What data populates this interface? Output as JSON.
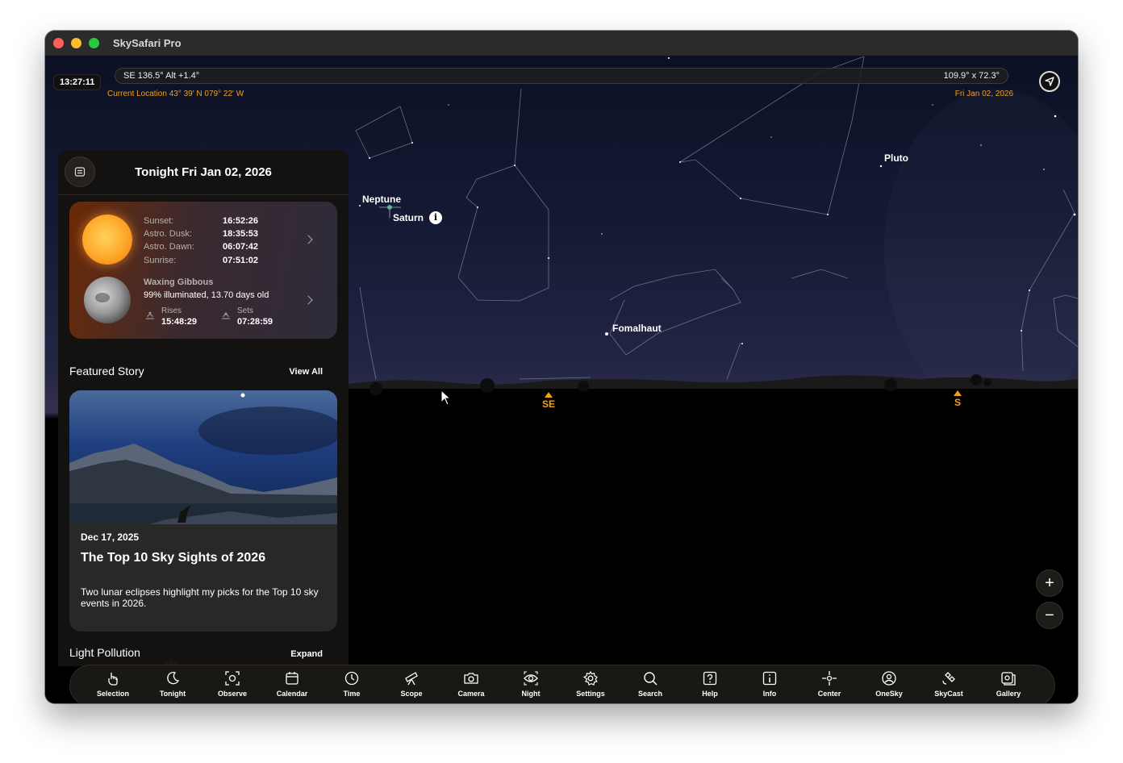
{
  "window": {
    "title": "SkySafari Pro"
  },
  "header": {
    "clock": "13:27:11",
    "pointing": "SE 136.5° Alt +1.4°",
    "fov": "109.9° x 72.3°",
    "location": "Current Location  43° 39' N 079° 22' W",
    "date": "Fri Jan 02, 2026"
  },
  "sky_labels": {
    "neptune": "Neptune",
    "saturn": "Saturn",
    "pluto": "Pluto",
    "fomalhaut": "Fomalhaut",
    "info_icon": "i",
    "compass_se": "SE",
    "compass_s": "S"
  },
  "zoom": {
    "in": "+",
    "out": "−"
  },
  "tonight_panel": {
    "title": "Tonight Fri Jan 02, 2026",
    "sun": [
      {
        "label": "Sunset:",
        "value": "16:52:26"
      },
      {
        "label": "Astro. Dusk:",
        "value": "18:35:53"
      },
      {
        "label": "Astro. Dawn:",
        "value": "06:07:42"
      },
      {
        "label": "Sunrise:",
        "value": "07:51:02"
      }
    ],
    "moon": {
      "phase": "Waxing Gibbous",
      "illumination": "99% illuminated, 13.70 days old",
      "rises_label": "Rises",
      "rises_value": "15:48:29",
      "sets_label": "Sets",
      "sets_value": "07:28:59"
    },
    "featured": {
      "section_title": "Featured Story",
      "view_all": "View All",
      "date": "Dec 17, 2025",
      "title": "The Top 10 Sky Sights of 2026",
      "description": "Two lunar eclipses highlight my picks for the Top 10 sky events in 2026."
    },
    "light_pollution": {
      "section_title": "Light Pollution",
      "expand": "Expand"
    }
  },
  "toolbar": [
    {
      "label": "Selection",
      "icon": "hand-pointer-icon"
    },
    {
      "label": "Tonight",
      "icon": "moon-icon"
    },
    {
      "label": "Observe",
      "icon": "observe-icon"
    },
    {
      "label": "Calendar",
      "icon": "calendar-icon"
    },
    {
      "label": "Time",
      "icon": "clock-icon"
    },
    {
      "label": "Scope",
      "icon": "telescope-icon"
    },
    {
      "label": "Camera",
      "icon": "camera-icon"
    },
    {
      "label": "Night",
      "icon": "eye-icon"
    },
    {
      "label": "Settings",
      "icon": "gear-icon"
    },
    {
      "label": "Search",
      "icon": "search-icon"
    },
    {
      "label": "Help",
      "icon": "help-icon"
    },
    {
      "label": "Info",
      "icon": "info-icon"
    },
    {
      "label": "Center",
      "icon": "crosshair-icon"
    },
    {
      "label": "OneSky",
      "icon": "onesky-icon"
    },
    {
      "label": "SkyCast",
      "icon": "satellite-icon"
    },
    {
      "label": "Gallery",
      "icon": "gallery-icon"
    }
  ],
  "colors": {
    "accent": "#f2a21a",
    "panel": "#141210",
    "toolbar": "#1a1815"
  }
}
